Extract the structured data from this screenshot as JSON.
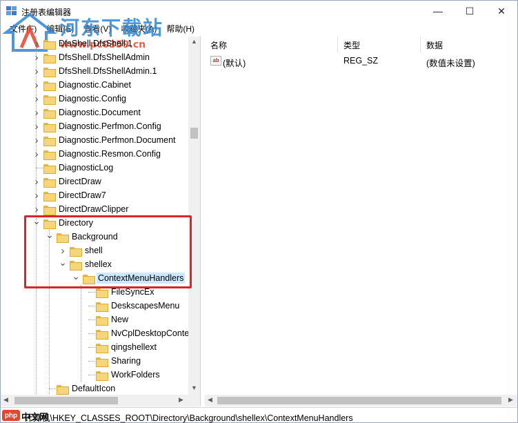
{
  "window": {
    "title": "注册表编辑器",
    "buttons": {
      "minimize": "—",
      "maximize": "☐",
      "close": "✕"
    }
  },
  "menu": [
    "文件(F)",
    "编辑(E)",
    "查看(V)",
    "收藏夹(A)",
    "帮助(H)"
  ],
  "watermark": {
    "site": "河东下载站",
    "url": "www.pc0359.cn"
  },
  "tree": [
    {
      "label": "DfsShell.DfsShell.1",
      "depth": 0,
      "expander": "collapsed"
    },
    {
      "label": "DfsShell.DfsShellAdmin",
      "depth": 0,
      "expander": "collapsed"
    },
    {
      "label": "DfsShell.DfsShellAdmin.1",
      "depth": 0,
      "expander": "collapsed"
    },
    {
      "label": "Diagnostic.Cabinet",
      "depth": 0,
      "expander": "collapsed"
    },
    {
      "label": "Diagnostic.Config",
      "depth": 0,
      "expander": "collapsed"
    },
    {
      "label": "Diagnostic.Document",
      "depth": 0,
      "expander": "collapsed"
    },
    {
      "label": "Diagnostic.Perfmon.Config",
      "depth": 0,
      "expander": "collapsed"
    },
    {
      "label": "Diagnostic.Perfmon.Document",
      "depth": 0,
      "expander": "collapsed"
    },
    {
      "label": "Diagnostic.Resmon.Config",
      "depth": 0,
      "expander": "collapsed"
    },
    {
      "label": "DiagnosticLog",
      "depth": 0,
      "expander": "none"
    },
    {
      "label": "DirectDraw",
      "depth": 0,
      "expander": "collapsed"
    },
    {
      "label": "DirectDraw7",
      "depth": 0,
      "expander": "collapsed"
    },
    {
      "label": "DirectDrawClipper",
      "depth": 0,
      "expander": "collapsed"
    },
    {
      "label": "Directory",
      "depth": 0,
      "expander": "expanded"
    },
    {
      "label": "Background",
      "depth": 1,
      "expander": "expanded"
    },
    {
      "label": "shell",
      "depth": 2,
      "expander": "collapsed"
    },
    {
      "label": "shellex",
      "depth": 2,
      "expander": "expanded"
    },
    {
      "label": "ContextMenuHandlers",
      "depth": 3,
      "expander": "expanded",
      "selected": true
    },
    {
      "label": " FileSyncEx",
      "depth": 4,
      "expander": "none"
    },
    {
      "label": "DeskscapesMenu",
      "depth": 4,
      "expander": "none"
    },
    {
      "label": "New",
      "depth": 4,
      "expander": "none"
    },
    {
      "label": "NvCplDesktopConte",
      "depth": 4,
      "expander": "none"
    },
    {
      "label": "qingshellext",
      "depth": 4,
      "expander": "none"
    },
    {
      "label": "Sharing",
      "depth": 4,
      "expander": "none"
    },
    {
      "label": "WorkFolders",
      "depth": 4,
      "expander": "none"
    },
    {
      "label": "DefaultIcon",
      "depth": 1,
      "expander": "none"
    }
  ],
  "values": {
    "columns": {
      "name": "名称",
      "type": "类型",
      "data": "数据"
    },
    "rows": [
      {
        "icon": "ab",
        "name": "(默认)",
        "type": "REG_SZ",
        "data": "(数值未设置)"
      }
    ]
  },
  "status": {
    "path": "计算机\\HKEY_CLASSES_ROOT\\Directory\\Background\\shellex\\ContextMenuHandlers",
    "logo_badge": "php",
    "logo_text": "中文网"
  },
  "colors": {
    "highlight": "#d6262a",
    "selection": "#cce8ff",
    "folder": "#f7d57a"
  }
}
